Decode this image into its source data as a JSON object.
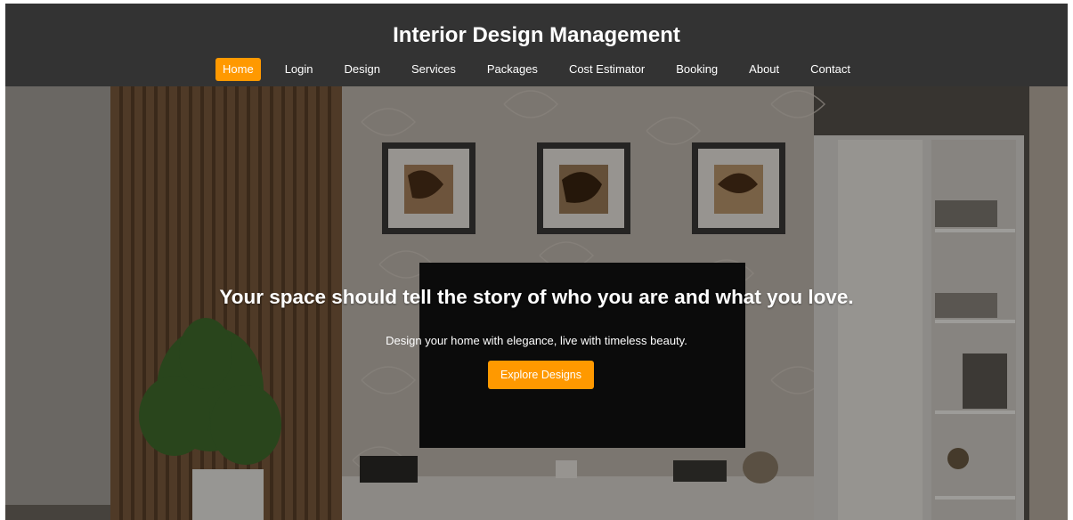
{
  "header": {
    "title": "Interior Design Management",
    "background": "#333333",
    "accent": "#ff9900"
  },
  "nav": {
    "items": [
      {
        "label": "Home",
        "active": true
      },
      {
        "label": "Login",
        "active": false
      },
      {
        "label": "Design",
        "active": false
      },
      {
        "label": "Services",
        "active": false
      },
      {
        "label": "Packages",
        "active": false
      },
      {
        "label": "Cost Estimator",
        "active": false
      },
      {
        "label": "Booking",
        "active": false
      },
      {
        "label": "About",
        "active": false
      },
      {
        "label": "Contact",
        "active": false
      }
    ]
  },
  "hero": {
    "heading": "Your space should tell the story of who you are and what you love.",
    "subtitle": "Design your home with elegance, live with timeless beauty.",
    "cta_label": "Explore Designs",
    "image_subject": "living room with TV wall, framed artworks, wooden slat panel, shelves and potted plant"
  }
}
